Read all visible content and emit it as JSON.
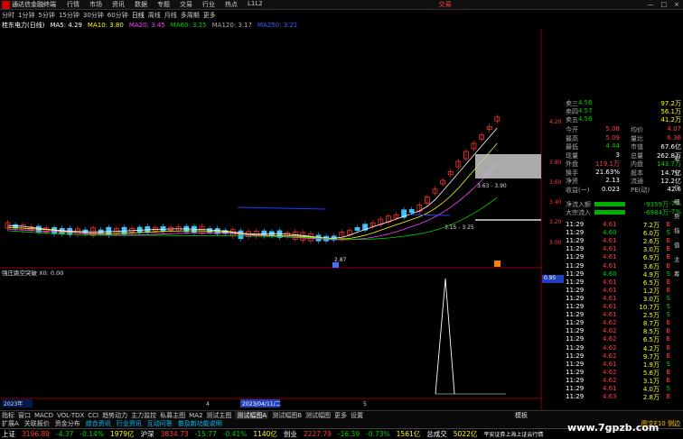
{
  "menu": {
    "app": "通达信金融终端",
    "items": [
      "行情",
      "市场",
      "资讯",
      "数据",
      "专题",
      "交易",
      "行业",
      "热点",
      "L1L2"
    ],
    "brand": "交易",
    "win": [
      "—",
      "□",
      "×"
    ]
  },
  "periods": [
    "分时",
    "1分钟",
    "5分钟",
    "15分钟",
    "30分钟",
    "60分钟",
    "日线",
    "周线",
    "月线",
    "多周期",
    "更多"
  ],
  "ticker": {
    "name": "桂东电力(日线)",
    "ma": [
      "MA5: 4.29",
      "MA10: 3.80",
      "MA20: 3.45",
      "MA60: 3.25",
      "MA120: 3.17"
    ],
    "extra": "MA250: 3.21"
  },
  "chart_data": {
    "type": "line",
    "price_axis": [
      "4.20",
      "3.80",
      "3.60",
      "3.40",
      "3.20",
      "3.00"
    ],
    "annotations": [
      "3.63 - 3.90",
      "3.15 - 3.25",
      "2.87"
    ],
    "lower_indicator": "强庄跳空突破 X0: 0.00",
    "lower_value": "0.95",
    "x_labels": [
      "2023年",
      "4",
      "2023/04/11/二",
      "5"
    ]
  },
  "quote": {
    "ask_labels": [
      "卖三",
      "卖四",
      "卖五"
    ],
    "ask_prices": [
      "4.56",
      "4.57",
      "4.56"
    ],
    "ask_vols": [
      "97.2万",
      "56.1万",
      "41.2万"
    ],
    "rows": [
      [
        "今开",
        "5.08",
        "均价",
        "4.07"
      ],
      [
        "最高",
        "5.09",
        "量比",
        "6.36"
      ],
      [
        "最低",
        "4.44",
        "市值",
        "67.6亿"
      ],
      [
        "现量",
        "3",
        "总量",
        "262.8万"
      ],
      [
        "外盘",
        "119.1万",
        "内盘",
        "143.7万"
      ],
      [
        "换手",
        "21.63%",
        "股本",
        "14.7亿"
      ],
      [
        "净资",
        "2.13",
        "流通",
        "12.2亿"
      ],
      [
        "收益(一)",
        "0.023",
        "PE(动)",
        "42.6"
      ]
    ],
    "flow": [
      [
        "净流入额",
        "-9359万",
        "-7%"
      ],
      [
        "大宗流入",
        "-6984万",
        "-7%"
      ]
    ],
    "ticks": [
      [
        "11:29",
        "4.61",
        "7.2万",
        "B"
      ],
      [
        "11:29",
        "4.60",
        "6.0万",
        "S"
      ],
      [
        "11:29",
        "4.61",
        "2.6万",
        "B"
      ],
      [
        "11:29",
        "4.61",
        "3.0万",
        "B"
      ],
      [
        "11:29",
        "4.61",
        "6.9万",
        "B"
      ],
      [
        "11:29",
        "4.61",
        "3.6万",
        "B"
      ],
      [
        "11:29",
        "4.60",
        "4.9万",
        "S"
      ],
      [
        "11:29",
        "4.61",
        "6.5万",
        "B"
      ],
      [
        "11:29",
        "4.61",
        "1.2万",
        "B"
      ],
      [
        "11:29",
        "4.61",
        "3.0万",
        "S"
      ],
      [
        "11:29",
        "4.61",
        "10.7万",
        "S"
      ],
      [
        "11:29",
        "4.61",
        "2.5万",
        "S"
      ],
      [
        "11:29",
        "4.62",
        "8.7万",
        "B"
      ],
      [
        "11:29",
        "4.62",
        "8.5万",
        "B"
      ],
      [
        "11:29",
        "4.62",
        "6.5万",
        "B"
      ],
      [
        "11:29",
        "4.62",
        "4.2万",
        "B"
      ],
      [
        "11:29",
        "4.62",
        "9.7万",
        "B"
      ],
      [
        "11:29",
        "4.61",
        "1.9万",
        "S"
      ],
      [
        "11:29",
        "4.62",
        "5.6万",
        "B"
      ],
      [
        "11:29",
        "4.62",
        "3.1万",
        "B"
      ],
      [
        "11:29",
        "4.61",
        "4.0万",
        "S"
      ],
      [
        "11:29",
        "4.63",
        "2.8万",
        "B"
      ]
    ]
  },
  "side_tabs": [
    "笔",
    "分",
    "价",
    "细",
    "势",
    "指",
    "值",
    "主",
    "筹"
  ],
  "bottom_tabs": [
    "指标",
    "窗口",
    "MACD",
    "VOL-TDX",
    "CCI",
    "趋势动力",
    "主力监控",
    "私募主图",
    "MA2",
    "测试主图",
    "测试幅图A",
    "测试幅图B",
    "测试幅图",
    "更多",
    "设置"
  ],
  "bottom2": [
    "扩展A",
    "关联报价",
    "资金分布",
    "综合资讯",
    "行业资讯",
    "互动问答",
    "普及新功能说明"
  ],
  "bottom_right": [
    "模板",
    "图文F10",
    "侧边"
  ],
  "idx": [
    [
      "上证",
      "3196.89",
      "-4.37",
      "-0.14%",
      "1979亿"
    ],
    [
      "沪深",
      "3834.73",
      "-15.77",
      "-0.41%",
      "1140亿"
    ],
    [
      "创业",
      "2227.79",
      "-16.39",
      "-0.73%",
      "1561亿"
    ],
    [
      "总成交",
      "5022亿"
    ]
  ],
  "broker": "平安证券上海上证云行情",
  "watermark": "www.7gpzb.com"
}
